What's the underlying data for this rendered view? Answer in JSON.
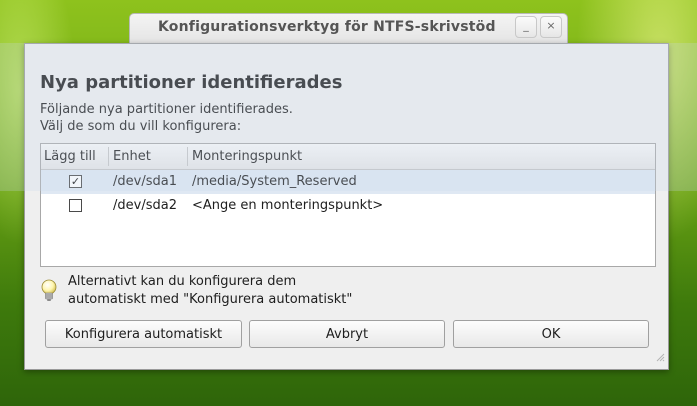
{
  "background_window": {
    "title": "Konfigurationsverktyg för NTFS-skrivstöd",
    "minimize_glyph": "_",
    "close_glyph": "×"
  },
  "dialog": {
    "heading": "Nya partitioner identifierades",
    "description_line1": "Följande nya partitioner identifierades.",
    "description_line2": "Välj de som du vill konfigurera:",
    "columns": [
      "Lägg till",
      "Enhet",
      "Monteringspunkt"
    ],
    "partitions": [
      {
        "checked": true,
        "check_glyph": "✓",
        "device": "/dev/sda1",
        "mountpoint": "/media/System_Reserved"
      },
      {
        "checked": false,
        "check_glyph": "",
        "device": "/dev/sda2",
        "mountpoint": "<Ange en monteringspunkt>"
      }
    ],
    "info_line1": "Alternativt kan du konfigurera dem",
    "info_line2": "automatiskt med \"Konfigurera automatiskt\"",
    "info_icon": "lightbulb-icon",
    "buttons": {
      "auto": "Konfigurera automatiskt",
      "cancel": "Avbryt",
      "ok": "OK"
    }
  },
  "colors": {
    "desktop_green": "#6aa314",
    "selection": "#dfe8f3",
    "dialog_bg": "#efefef"
  }
}
